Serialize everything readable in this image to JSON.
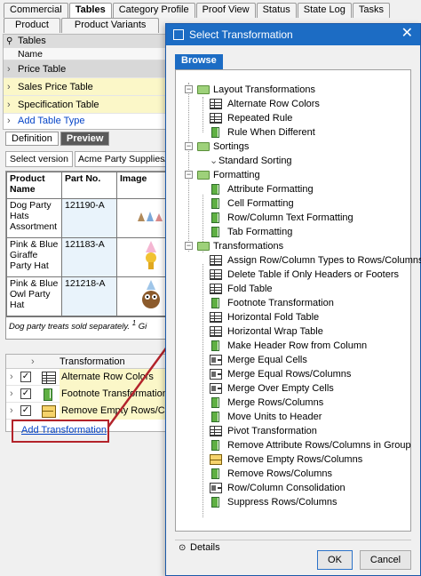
{
  "top_tabs": [
    "Commercial",
    "Tables",
    "Category Profile",
    "Proof View",
    "Status",
    "State Log",
    "Tasks"
  ],
  "second_tabs": [
    "Product",
    "Product Variants"
  ],
  "tables_tree": {
    "header": "Tables",
    "column_name": "Name",
    "items": [
      "Price Table",
      "Sales Price Table",
      "Specification Table"
    ],
    "add_link": "Add Table Type"
  },
  "def_tabs": [
    "Definition",
    "Preview"
  ],
  "version": {
    "label": "Select version",
    "value": "Acme Party Supplies/E"
  },
  "preview_table": {
    "headers": [
      "Product Name",
      "Part No.",
      "Image"
    ],
    "rows": [
      [
        "Dog Party Hats Assortment",
        "121190-A",
        ""
      ],
      [
        "Pink & Blue Giraffe Party Hat",
        "121183-A",
        ""
      ],
      [
        "Pink & Blue Owl Party Hat",
        "121218-A",
        ""
      ]
    ],
    "footnote": "Dog party treats sold separately.",
    "footnote_mark": "1",
    "footnote_tail": "Gi"
  },
  "transform_grid": {
    "header": "Transformation",
    "rows": [
      "Alternate Row Colors",
      "Footnote Transformation",
      "Remove Empty Rows/Columns"
    ],
    "add_link": "Add Transformation"
  },
  "dialog": {
    "title": "Select Transformation",
    "close": "✕",
    "browse_tab": "Browse",
    "groups": [
      {
        "label": "Layout Transformations",
        "items": [
          "Alternate Row Colors",
          "Repeated Rule",
          "Rule When Different"
        ]
      },
      {
        "label": "Sortings",
        "items": [
          "Standard Sorting"
        ]
      },
      {
        "label": "Formatting",
        "items": [
          "Attribute Formatting",
          "Cell Formatting",
          "Row/Column Text Formatting",
          "Tab Formatting"
        ]
      },
      {
        "label": "Transformations",
        "items": [
          "Assign Row/Column Types to Rows/Columns",
          "Delete Table if Only Headers or Footers",
          "Fold Table",
          "Footnote Transformation",
          "Horizontal Fold Table",
          "Horizontal Wrap Table",
          "Make Header Row from Column",
          "Merge Equal Cells",
          "Merge Equal Rows/Columns",
          "Merge Over Empty Cells",
          "Merge Rows/Columns",
          "Move Units to Header",
          "Pivot Transformation",
          "Remove Attribute Rows/Columns in Group",
          "Remove Empty Rows/Columns",
          "Remove Rows/Columns",
          "Row/Column Consolidation",
          "Suppress Rows/Columns"
        ]
      }
    ],
    "details": "Details",
    "ok": "OK",
    "cancel": "Cancel"
  },
  "colors": {
    "accent": "#1c6cc4",
    "highlight_box": "#b3232a",
    "row_yellow": "#fbf7c8",
    "folder": "#9ed17a"
  }
}
